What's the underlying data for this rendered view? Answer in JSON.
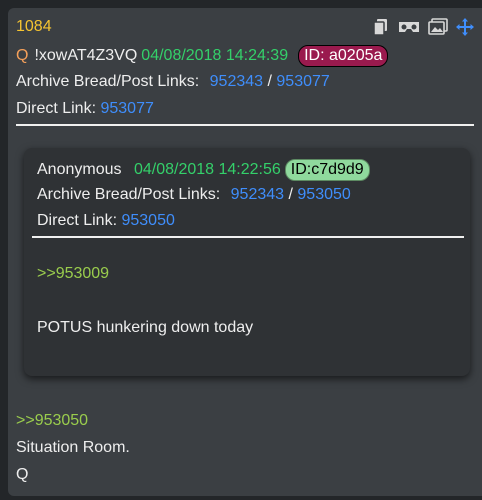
{
  "post": {
    "number": "1084",
    "icons": [
      "copy-icon",
      "vr-icon",
      "image-icon",
      "move-icon"
    ],
    "header": {
      "q_label": "Q",
      "tripcode": "!xowAT4Z3VQ",
      "date": "04/08/2018 14:24:39",
      "id": "ID: a0205a"
    },
    "archive_label": "Archive Bread/Post Links:",
    "archive_link_1": "952343",
    "archive_separator": "/",
    "archive_link_2": "953077",
    "direct_label": "Direct Link:",
    "direct_link": "953077",
    "reply_ref": ">>953050",
    "body_line_1": "Situation Room.",
    "body_line_2": "Q",
    "colors": {
      "background": "#3b3f43",
      "post_number": "#f5c431",
      "date": "#34d06a",
      "link": "#3f8efc",
      "greentext": "#9acd4d",
      "id_badge_outer": "#9a1a4e",
      "id_badge_inner": "#8fd99d"
    }
  },
  "quoted": {
    "author": "Anonymous",
    "date": "04/08/2018 14:22:56",
    "id": "ID:c7d9d9",
    "archive_label": "Archive Bread/Post Links:",
    "archive_link_1": "952343",
    "archive_separator": "/",
    "archive_link_2": "953050",
    "direct_label": "Direct Link:",
    "direct_link": "953050",
    "reply_ref": ">>953009",
    "body": "POTUS hunkering down today"
  }
}
